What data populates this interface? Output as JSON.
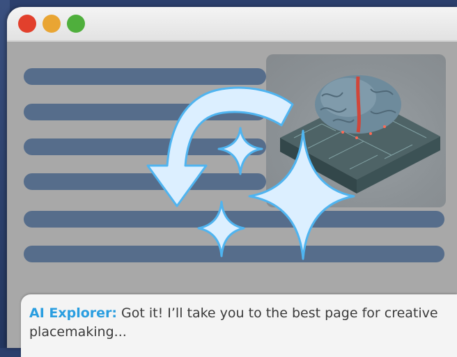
{
  "chat": {
    "speaker": "AI Explorer:",
    "message": " Got it! I’ll take you to the best page for creative placemaking..."
  },
  "window": {
    "controls": [
      "close",
      "minimize",
      "maximize"
    ]
  },
  "icons": {
    "brain": "brain-chip-icon",
    "redo": "curved-arrow-icon",
    "sparkles": "sparkle-icon"
  },
  "colors": {
    "accent": "#2a9ee0",
    "text_line": "#566d8b",
    "arrow_fill": "#dcefff",
    "arrow_stroke": "#4fb4f0"
  }
}
